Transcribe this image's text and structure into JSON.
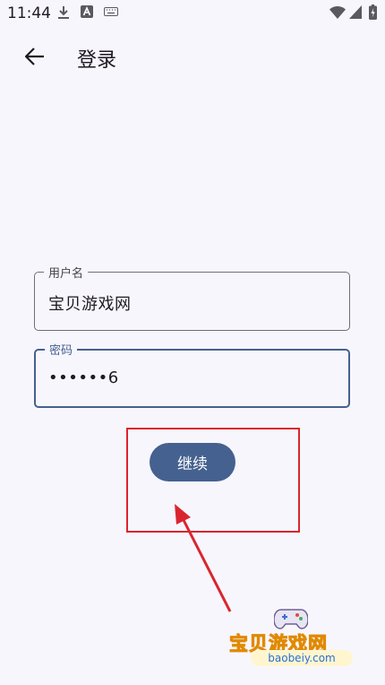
{
  "status_bar": {
    "time": "11:44",
    "icons": [
      "download-icon",
      "font-icon",
      "keyboard-icon",
      "wifi-icon",
      "signal-icon",
      "battery-charging-icon"
    ]
  },
  "app_bar": {
    "back_icon": "arrow-left-icon",
    "title": "登录"
  },
  "form": {
    "username": {
      "label": "用户名",
      "value": "宝贝游戏网"
    },
    "password": {
      "label": "密码",
      "value": "••••••6"
    },
    "submit_label": "继续"
  },
  "annotation": {
    "color": "#d9262e"
  },
  "watermark": {
    "text": "宝贝游戏网",
    "url": "baobeiy.com"
  },
  "colors": {
    "primary": "#45618f",
    "background": "#f8f6fd"
  }
}
